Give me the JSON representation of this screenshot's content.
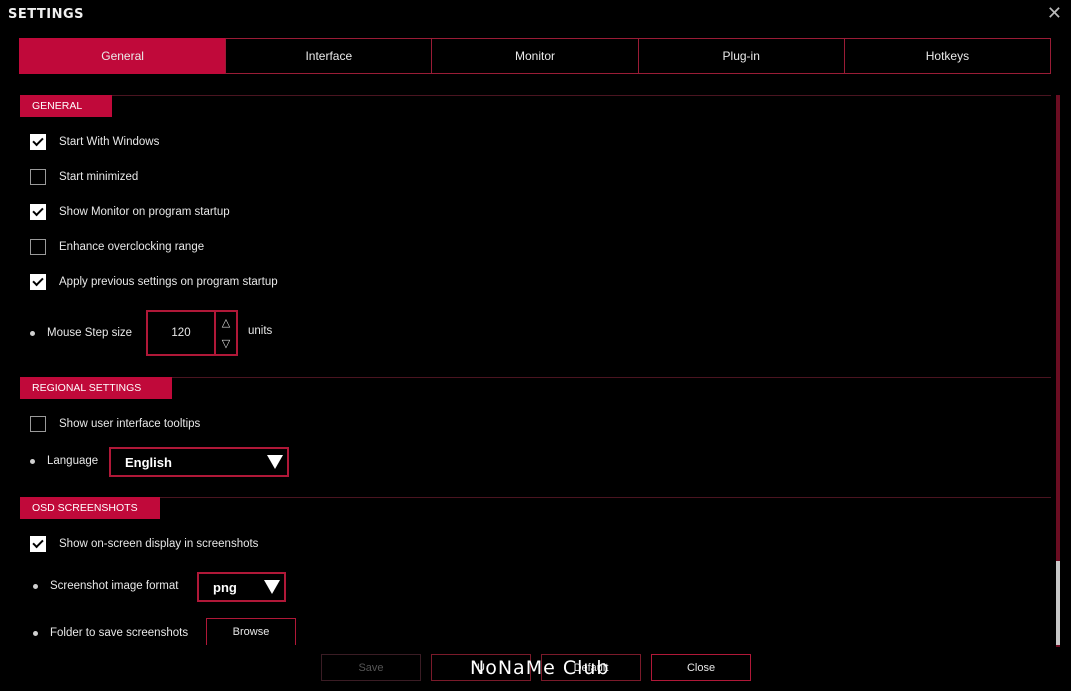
{
  "window": {
    "title": "SETTINGS",
    "close_glyph": "✕"
  },
  "tabs": [
    {
      "label": "General",
      "active": true
    },
    {
      "label": "Interface",
      "active": false
    },
    {
      "label": "Monitor",
      "active": false
    },
    {
      "label": "Plug-in",
      "active": false
    },
    {
      "label": "Hotkeys",
      "active": false
    }
  ],
  "general": {
    "header": "GENERAL",
    "options": [
      {
        "label": "Start With Windows",
        "checked": true
      },
      {
        "label": "Start minimized",
        "checked": false
      },
      {
        "label": "Show Monitor on program startup",
        "checked": true
      },
      {
        "label": "Enhance overclocking range",
        "checked": false
      },
      {
        "label": "Apply previous settings on program startup",
        "checked": true
      }
    ],
    "mouse_step": {
      "label": "Mouse Step size",
      "value": "120",
      "up": "△",
      "down": "▽",
      "units": "units"
    }
  },
  "regional": {
    "header": "REGIONAL SETTINGS",
    "tooltips": {
      "label": "Show user interface tooltips",
      "checked": false
    },
    "language": {
      "label": "Language",
      "value": "English"
    }
  },
  "osd": {
    "header": "OSD SCREENSHOTS",
    "show_osd": {
      "label": "Show on-screen display in screenshots",
      "checked": true
    },
    "format": {
      "label": "Screenshot image format",
      "value": "png"
    },
    "folder": {
      "label": "Folder to save screenshots",
      "button": "Browse"
    }
  },
  "footer": {
    "save": "Save",
    "undo": "U",
    "default": "Default",
    "close": "Close",
    "watermark": "NoNaMe Club"
  },
  "colors": {
    "accent": "#c0093a",
    "border": "#b01838",
    "background": "#000000"
  }
}
